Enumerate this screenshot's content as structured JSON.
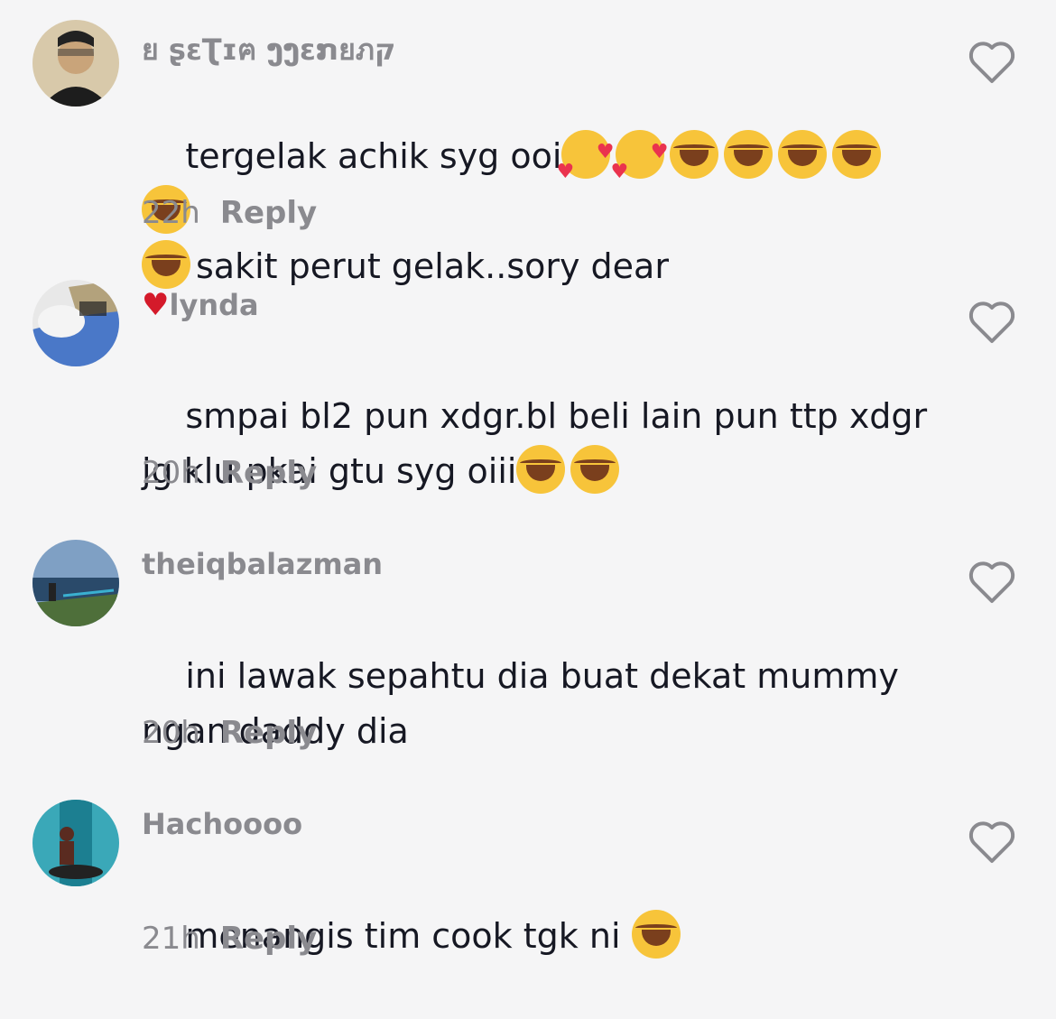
{
  "comments": [
    {
      "username": "ย ʂɛƮɪฅ ງງɛກยภק",
      "text_line1": "tergelak achik syg ooi",
      "text_line2": "sakit perut gelak..sory dear",
      "time": "22h",
      "reply_label": "Reply",
      "avatar_colors": [
        "#d8c9aa",
        "#1d1d1d",
        "#c9a47a"
      ]
    },
    {
      "username_prefix": "♥",
      "username": "lynda",
      "text_line1": "smpai bl2 pun xdgr.bl beli lain pun ttp xdgr",
      "text_line2": "jg klu pkai gtu syg oiii",
      "time": "20h",
      "reply_label": "Reply",
      "avatar_colors": [
        "#e8e8e8",
        "#4a78c8",
        "#b3a27c"
      ]
    },
    {
      "username": "theiqbalazman",
      "text_line1": "ini lawak sepahtu dia buat dekat mummy",
      "text_line2": "ngan daddy dia",
      "time": "20h",
      "reply_label": "Reply",
      "avatar_colors": [
        "#7fa0c4",
        "#2a4a6a",
        "#4e6f3a"
      ]
    },
    {
      "username": "Hachoooo",
      "text_line1": "menangis tim cook tgk ni",
      "time": "21h",
      "reply_label": "Reply",
      "avatar_colors": [
        "#3aa8b8",
        "#5a2b20",
        "#1c7f91"
      ]
    }
  ]
}
